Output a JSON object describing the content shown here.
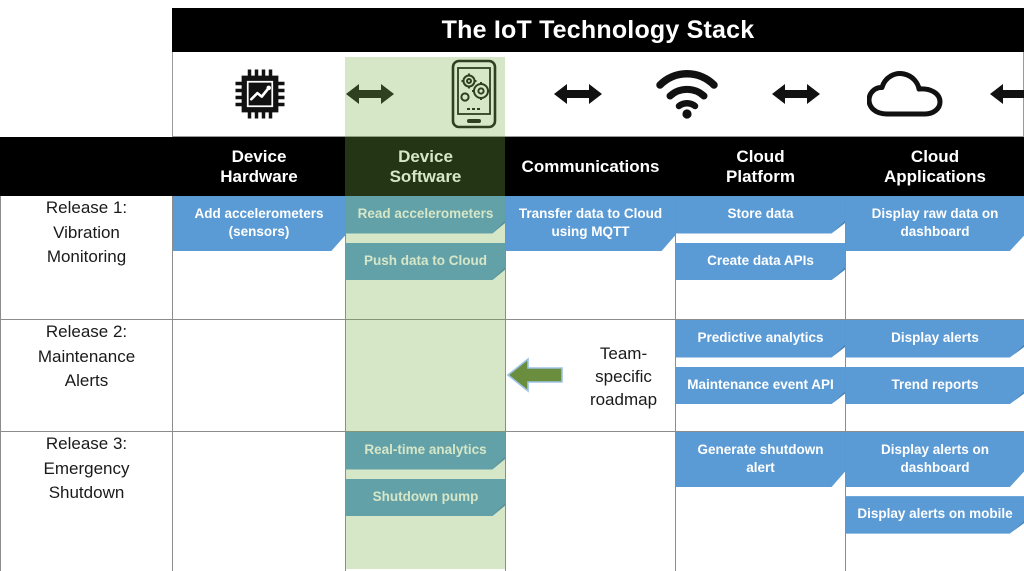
{
  "title": "The IoT Technology Stack",
  "icons": [
    {
      "name": "microchip-sensor-icon",
      "column": "Device Hardware"
    },
    {
      "name": "double-arrow-icon",
      "column": ""
    },
    {
      "name": "smartphone-gears-icon",
      "column": "Device Software"
    },
    {
      "name": "double-arrow-icon",
      "column": ""
    },
    {
      "name": "wifi-icon",
      "column": "Communications"
    },
    {
      "name": "double-arrow-icon",
      "column": ""
    },
    {
      "name": "cloud-icon",
      "column": "Cloud Platform"
    },
    {
      "name": "double-arrow-icon",
      "column": ""
    },
    {
      "name": "dashboard-window-icon",
      "column": "Cloud Applications"
    }
  ],
  "columns": [
    {
      "id": "row-label",
      "label": ""
    },
    {
      "id": "device-hardware",
      "label": "Device\nHardware"
    },
    {
      "id": "device-software",
      "label": "Device\nSoftware",
      "highlighted": true
    },
    {
      "id": "communications",
      "label": "Communications"
    },
    {
      "id": "cloud-platform",
      "label": "Cloud\nPlatform"
    },
    {
      "id": "cloud-applications",
      "label": "Cloud\nApplications"
    }
  ],
  "column_labels": {
    "device_hardware_line1": "Device",
    "device_hardware_line2": "Hardware",
    "device_software_line1": "Device",
    "device_software_line2": "Software",
    "communications": "Communications",
    "cloud_platform_line1": "Cloud",
    "cloud_platform_line2": "Platform",
    "cloud_applications_line1": "Cloud",
    "cloud_applications_line2": "Applications"
  },
  "rows": [
    {
      "id": "release-1",
      "label_line1": "Release 1:",
      "label_line2": "Vibration",
      "label_line3": "Monitoring",
      "device_hardware": [
        "Add accelerometers (sensors)"
      ],
      "device_software": [
        "Read accelerometers",
        "Push data to Cloud"
      ],
      "communications": [
        "Transfer data to Cloud using MQTT"
      ],
      "cloud_platform": [
        "Store data",
        "Create data APIs"
      ],
      "cloud_applications": [
        "Display raw data on dashboard"
      ]
    },
    {
      "id": "release-2",
      "label_line1": "Release 2:",
      "label_line2": "Maintenance",
      "label_line3": "Alerts",
      "device_hardware": [],
      "device_software": [],
      "communications_note_line1": "Team-",
      "communications_note_line2": "specific",
      "communications_note_line3": "roadmap",
      "cloud_platform": [
        "Predictive analytics",
        "Maintenance event API"
      ],
      "cloud_applications": [
        "Display alerts",
        "Trend reports"
      ]
    },
    {
      "id": "release-3",
      "label_line1": "Release 3:",
      "label_line2": "Emergency",
      "label_line3": "Shutdown",
      "device_hardware": [],
      "device_software": [
        "Real-time analytics",
        "Shutdown pump"
      ],
      "communications": [],
      "cloud_platform": [
        "Generate shutdown alert"
      ],
      "cloud_applications": [
        "Display alerts on dashboard",
        "Display alerts on mobile"
      ]
    }
  ],
  "colors": {
    "card_blue": "#5b9bd5",
    "card_fold": "#4a86bb",
    "header_black": "#000000",
    "highlight_green": "#cfe2c0",
    "roadmap_arrow_green": "#6b8e3e",
    "text_white": "#ffffff",
    "text_dark": "#1a1a1a"
  }
}
